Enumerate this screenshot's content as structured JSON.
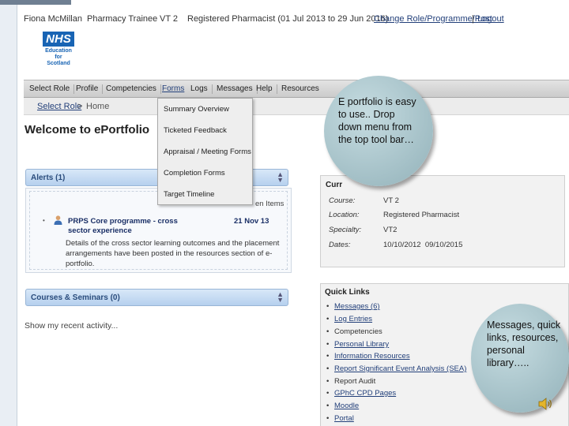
{
  "userbar": {
    "name": "Fiona McMillan",
    "role": "Pharmacy Trainee",
    "programme": "VT 2",
    "registration": "Registered Pharmacist (01 Jul 2013 to 29 Jun 2016)",
    "change_link": "Change Role/Programme/Post",
    "separator": "|",
    "logout_link": "Logout"
  },
  "logo": {
    "nhs": "NHS",
    "line1": "Education",
    "line2": "for",
    "line3": "Scotland"
  },
  "nav": {
    "items": [
      "Select Role",
      "Profile",
      "Competencies",
      "Forms",
      "Logs",
      "Messages",
      "Help",
      "Resources"
    ]
  },
  "breadcrumb": {
    "select_role": "Select Role",
    "separator": ">",
    "home": "Home"
  },
  "page_title": "Welcome to ePortfolio",
  "forms_menu": {
    "items": [
      "Summary Overview",
      "Ticketed Feedback",
      "Appraisal / Meeting Forms",
      "Completion Forms",
      "Target Timeline"
    ]
  },
  "alerts": {
    "header": "Alerts (1)",
    "hidden_items": "en Items",
    "title": "PRPS Core programme - cross sector experience",
    "date": "21 Nov 13",
    "body": "Details of the cross sector learning outcomes and the placement arrangements have been posted in the resources section of e-portfolio."
  },
  "courses": {
    "header": "Courses & Seminars (0)"
  },
  "recent_activity": "Show my recent activity...",
  "current": {
    "title": "Curr",
    "rows": [
      {
        "label": "Course:",
        "value": "VT 2"
      },
      {
        "label": "Location:",
        "value": "Registered Pharmacist"
      },
      {
        "label": "Specialty:",
        "value": "VT2"
      },
      {
        "label": "Dates:",
        "value": "10/10/2012  09/10/2015"
      }
    ]
  },
  "quick_links": {
    "title": "Quick Links",
    "items": [
      {
        "label": "Messages (6)",
        "link": true
      },
      {
        "label": "Log Entries",
        "link": true
      },
      {
        "label": "Competencies",
        "link": false
      },
      {
        "label": "Personal Library",
        "link": true
      },
      {
        "label": "Information Resources",
        "link": true
      },
      {
        "label": "Report Significant Event Analysis (SEA)",
        "link": true
      },
      {
        "label": "Report Audit",
        "link": false
      },
      {
        "label": "GPhC CPD Pages",
        "link": true
      },
      {
        "label": "Moodle",
        "link": true
      },
      {
        "label": "Portal",
        "link": true
      }
    ]
  },
  "callout_top": "E portfolio is easy to use.. Drop down menu from the top tool bar…",
  "callout_bottom": "Messages, quick links, resources, personal library…..",
  "colors": {
    "nhs_blue": "#1864b4",
    "link_blue": "#23407a",
    "panel_header": "#b6d0ee",
    "callout": "#9fbcc3"
  }
}
